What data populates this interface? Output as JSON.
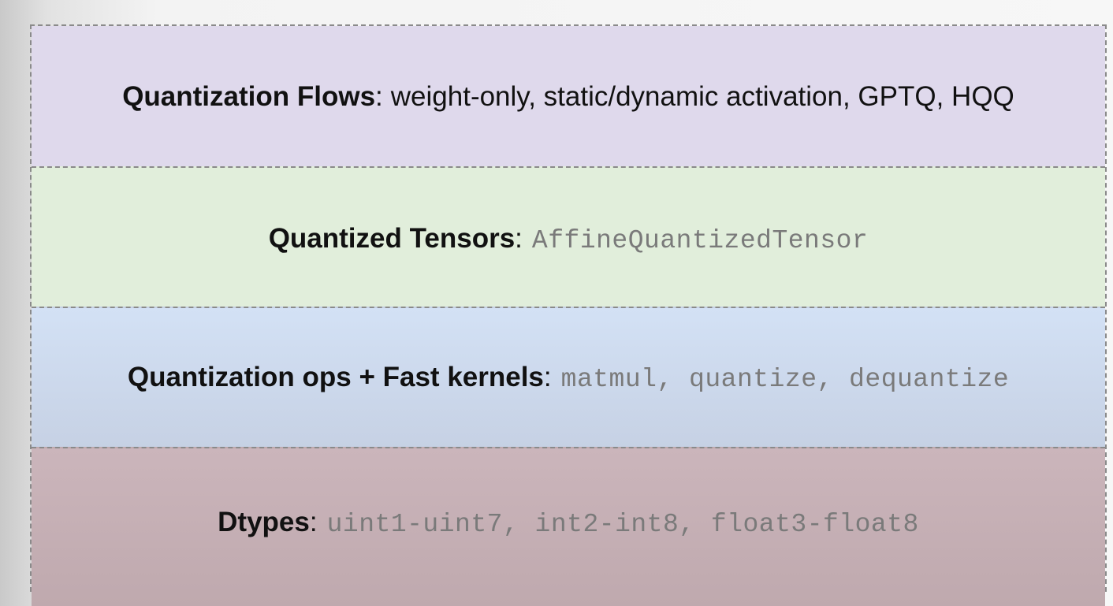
{
  "layers": [
    {
      "title": "Quantization Flows",
      "separator": ":",
      "detail": "weight-only, static/dynamic activation, GPTQ, HQQ",
      "detail_style": "plain",
      "background": "#dfd9ec"
    },
    {
      "title": "Quantized Tensors",
      "separator": ":",
      "detail": "AffineQuantizedTensor",
      "detail_style": "code",
      "background": "#e1eedb"
    },
    {
      "title": "Quantization ops + Fast kernels",
      "separator": ":",
      "detail": "matmul, quantize, dequantize",
      "detail_style": "code",
      "background": "#cfdcf1"
    },
    {
      "title": "Dtypes",
      "separator": ":",
      "detail": "uint1-uint7, int2-int8, float3-float8",
      "detail_style": "code",
      "background": "#c6b0b5"
    }
  ]
}
